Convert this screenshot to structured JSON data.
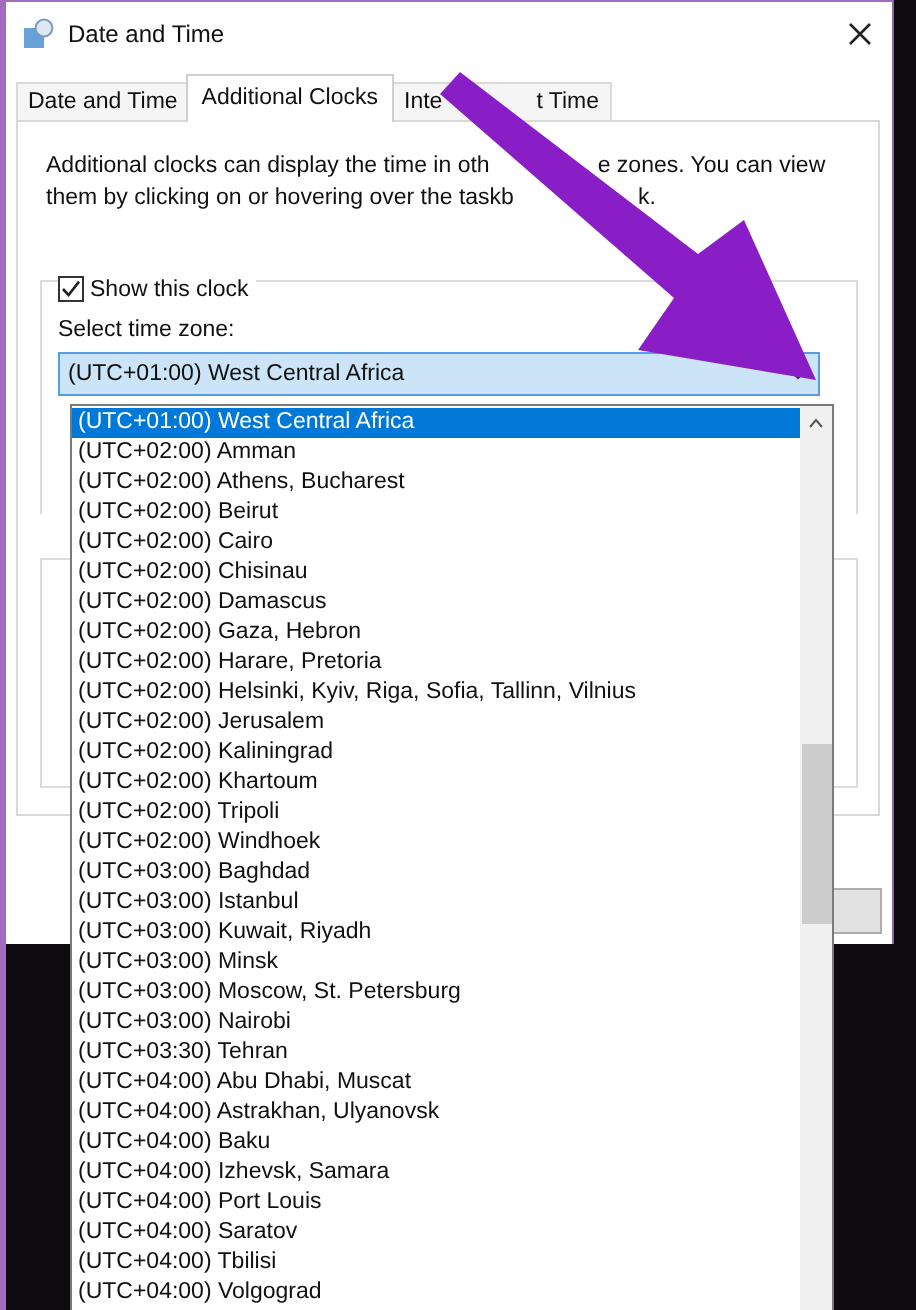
{
  "window": {
    "title": "Date and Time"
  },
  "tabs": [
    {
      "parts": [
        "Date and Time"
      ],
      "selected": false
    },
    {
      "parts": [
        "Additional Clocks"
      ],
      "selected": true
    },
    {
      "parts": [
        "Inte",
        "t Time"
      ],
      "selected": false
    }
  ],
  "description_lines": [
    [
      "Additional clocks can display the time in oth",
      "e zones. You can view"
    ],
    [
      "them by clicking on or hovering over the taskb",
      "k."
    ]
  ],
  "clock": {
    "label": "Show this clock",
    "checked": true,
    "zone_label": "Select time zone:",
    "zone_value": "(UTC+01:00) West Central Africa",
    "options": [
      {
        "label": "(UTC+01:00) West Central Africa",
        "selected": true
      },
      {
        "label": "(UTC+02:00) Amman",
        "selected": false
      },
      {
        "label": "(UTC+02:00) Athens, Bucharest",
        "selected": false
      },
      {
        "label": "(UTC+02:00) Beirut",
        "selected": false
      },
      {
        "label": "(UTC+02:00) Cairo",
        "selected": false
      },
      {
        "label": "(UTC+02:00) Chisinau",
        "selected": false
      },
      {
        "label": "(UTC+02:00) Damascus",
        "selected": false
      },
      {
        "label": "(UTC+02:00) Gaza, Hebron",
        "selected": false
      },
      {
        "label": "(UTC+02:00) Harare, Pretoria",
        "selected": false
      },
      {
        "label": "(UTC+02:00) Helsinki, Kyiv, Riga, Sofia, Tallinn, Vilnius",
        "selected": false
      },
      {
        "label": "(UTC+02:00) Jerusalem",
        "selected": false
      },
      {
        "label": "(UTC+02:00) Kaliningrad",
        "selected": false
      },
      {
        "label": "(UTC+02:00) Khartoum",
        "selected": false
      },
      {
        "label": "(UTC+02:00) Tripoli",
        "selected": false
      },
      {
        "label": "(UTC+02:00) Windhoek",
        "selected": false
      },
      {
        "label": "(UTC+03:00) Baghdad",
        "selected": false
      },
      {
        "label": "(UTC+03:00) Istanbul",
        "selected": false
      },
      {
        "label": "(UTC+03:00) Kuwait, Riyadh",
        "selected": false
      },
      {
        "label": "(UTC+03:00) Minsk",
        "selected": false
      },
      {
        "label": "(UTC+03:00) Moscow, St. Petersburg",
        "selected": false
      },
      {
        "label": "(UTC+03:00) Nairobi",
        "selected": false
      },
      {
        "label": "(UTC+03:30) Tehran",
        "selected": false
      },
      {
        "label": "(UTC+04:00) Abu Dhabi, Muscat",
        "selected": false
      },
      {
        "label": "(UTC+04:00) Astrakhan, Ulyanovsk",
        "selected": false
      },
      {
        "label": "(UTC+04:00) Baku",
        "selected": false
      },
      {
        "label": "(UTC+04:00) Izhevsk, Samara",
        "selected": false
      },
      {
        "label": "(UTC+04:00) Port Louis",
        "selected": false
      },
      {
        "label": "(UTC+04:00) Saratov",
        "selected": false
      },
      {
        "label": "(UTC+04:00) Tbilisi",
        "selected": false
      },
      {
        "label": "(UTC+04:00) Volgograd",
        "selected": false
      }
    ]
  }
}
